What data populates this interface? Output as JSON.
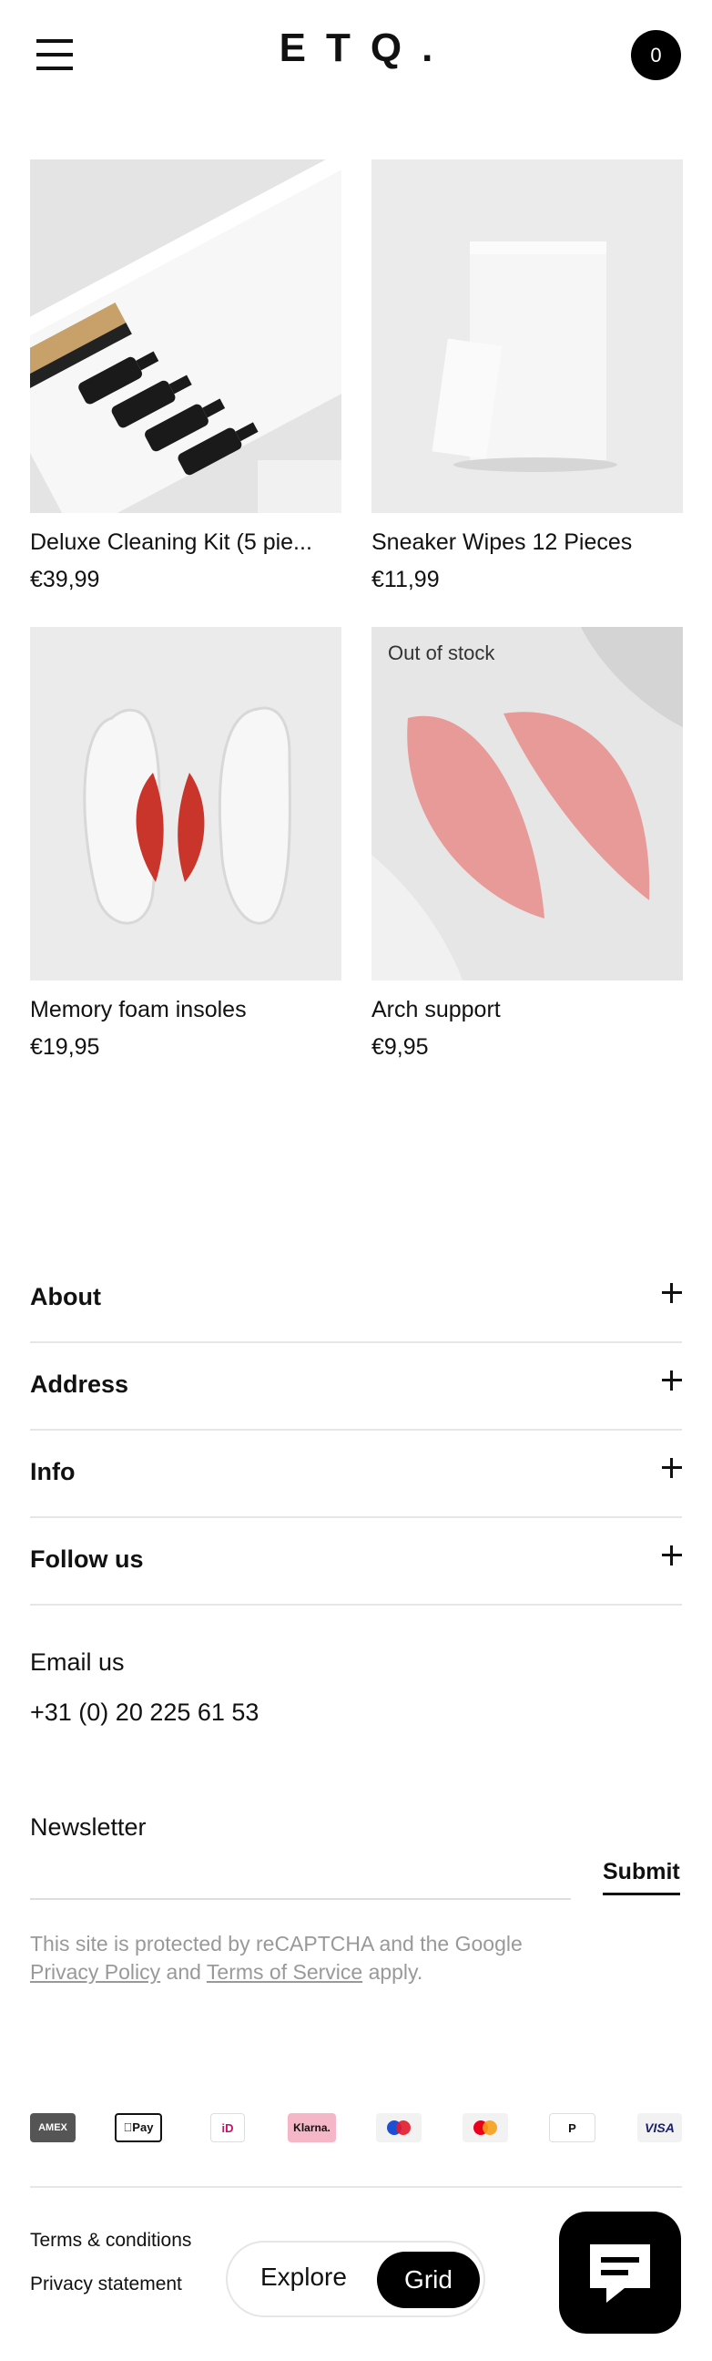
{
  "header": {
    "logo": "ETQ.",
    "cart_count": "0"
  },
  "products": [
    {
      "name": "Deluxe Cleaning Kit (5 pie...",
      "price": "€39,99"
    },
    {
      "name": "Sneaker Wipes 12 Pieces",
      "price": "€11,99"
    },
    {
      "name": "Memory foam insoles",
      "price": "€19,95"
    },
    {
      "name": "Arch support",
      "price": "€9,95",
      "badge": "Out of stock"
    }
  ],
  "footer": {
    "accordion": [
      {
        "label": "About"
      },
      {
        "label": "Address"
      },
      {
        "label": "Info"
      },
      {
        "label": "Follow us"
      }
    ],
    "email_label": "Email us",
    "phone": "+31 (0) 20 225 61 53",
    "newsletter_label": "Newsletter",
    "submit_label": "Submit",
    "recaptcha": {
      "prefix": "This site is protected by reCAPTCHA and the Google",
      "privacy": "Privacy Policy",
      "and": "and",
      "terms": "Terms of Service",
      "suffix": "apply."
    },
    "payment_methods": [
      {
        "label": "AMEX"
      },
      {
        "label": "Pay"
      },
      {
        "label": "iD"
      },
      {
        "label": "Klarna."
      },
      {
        "label": "Maestro"
      },
      {
        "label": "Mastercard"
      },
      {
        "label": "P"
      },
      {
        "label": "VISA"
      }
    ],
    "terms_label": "Terms & conditions",
    "privacy_label": "Privacy statement"
  },
  "view_toggle": {
    "explore": "Explore",
    "grid": "Grid"
  },
  "colors": {
    "accent": "#000000",
    "product_bg": "#ebebeb",
    "insole_accent": "#c9352a",
    "arch_pink": "#e89a98"
  }
}
